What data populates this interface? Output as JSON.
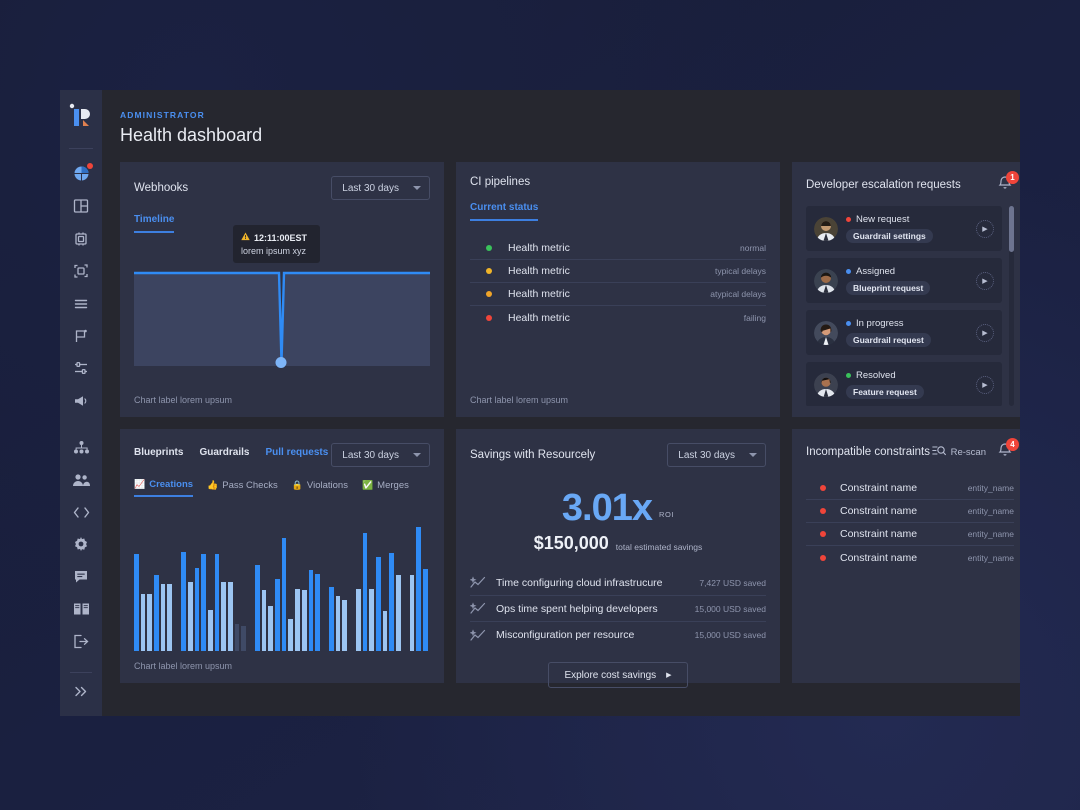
{
  "header": {
    "eyebrow": "ADMINISTRATOR",
    "title": "Health dashboard"
  },
  "sidebar": {
    "logo_name": "resourcely-logo",
    "items": [
      {
        "icon": "pie-chart-icon",
        "name": "dashboard",
        "has_dot": true
      },
      {
        "icon": "layout-panels-icon",
        "name": "blueprints",
        "has_dot": false
      },
      {
        "icon": "chip-icon",
        "name": "resources",
        "has_dot": false
      },
      {
        "icon": "frame-icon",
        "name": "guardrails",
        "has_dot": false
      },
      {
        "icon": "list-lines-icon",
        "name": "logs",
        "has_dot": false
      },
      {
        "icon": "flag-icon",
        "name": "campaigns",
        "has_dot": false
      },
      {
        "icon": "sliders-icon",
        "name": "settings-tuning",
        "has_dot": false
      },
      {
        "icon": "megaphone-icon",
        "name": "announcements",
        "has_dot": false
      },
      {
        "icon": "org-chart-icon",
        "name": "teams",
        "has_dot": false
      },
      {
        "icon": "users-icon",
        "name": "users",
        "has_dot": false
      }
    ],
    "bottom_items": [
      {
        "icon": "code-brackets-icon",
        "name": "developers"
      },
      {
        "icon": "gear-icon",
        "name": "settings"
      },
      {
        "icon": "chat-icon",
        "name": "support-chat"
      },
      {
        "icon": "book-icon",
        "name": "documentation"
      },
      {
        "icon": "logout-icon",
        "name": "logout"
      }
    ],
    "expand": {
      "icon": "chevron-double-right-icon",
      "name": "expand-sidebar"
    }
  },
  "webhooks": {
    "title": "Webhooks",
    "range": "Last 30 days",
    "tabs": [
      {
        "label": "Timeline",
        "active": true
      }
    ],
    "tooltip": {
      "time": "12:11:00EST",
      "text": "lorem ipsum xyz",
      "icon": "warning-icon"
    },
    "chart_label": "Chart label lorem upsum"
  },
  "ci": {
    "title": "CI pipelines",
    "tabs": [
      {
        "label": "Current status",
        "active": true
      }
    ],
    "rows": [
      {
        "label": "Health metric",
        "status": "normal",
        "color": "#3ac25b"
      },
      {
        "label": "Health metric",
        "status": "typical delays",
        "color": "#f0b429"
      },
      {
        "label": "Health metric",
        "status": "atypical delays",
        "color": "#f0a429"
      },
      {
        "label": "Health metric",
        "status": "failing",
        "color": "#f0453a"
      }
    ],
    "chart_label": "Chart label lorem upsum"
  },
  "escalation": {
    "title": "Developer escalation requests",
    "badge": "1",
    "bell_icon": "bell-icon",
    "items": [
      {
        "status": "New request",
        "dot": "#f0453a",
        "chip": "Guardrail settings",
        "avatar": "avatar-1"
      },
      {
        "status": "Assigned",
        "dot": "#4a8ff0",
        "chip": "Blueprint request",
        "avatar": "avatar-2"
      },
      {
        "status": "In progress",
        "dot": "#4a8ff0",
        "chip": "Guardrail request",
        "avatar": "avatar-3"
      },
      {
        "status": "Resolved",
        "dot": "#3ac25b",
        "chip": "Feature request",
        "avatar": "avatar-4"
      }
    ]
  },
  "activity": {
    "tabs": [
      {
        "label": "Blueprints",
        "active": false
      },
      {
        "label": "Guardrails",
        "active": false
      },
      {
        "label": "Pull requests",
        "active": true
      }
    ],
    "range": "Last 30 days",
    "subtabs": [
      {
        "label": "Creations",
        "emoji": "📈",
        "active": true
      },
      {
        "label": "Pass Checks",
        "emoji": "👍",
        "active": false
      },
      {
        "label": "Violations",
        "emoji": "🔒",
        "active": false
      },
      {
        "label": "Merges",
        "emoji": "✅",
        "active": false
      }
    ],
    "chart_label": "Chart label lorem upsum"
  },
  "savings": {
    "title": "Savings with Resourcely",
    "range": "Last 30 days",
    "roi_value": "3.01x",
    "roi_label": "ROI",
    "total_value": "$150,000",
    "total_label": "total estimated savings",
    "rows": [
      {
        "label": "Time configuring cloud infrastrucure",
        "amount": "7,427 USD saved",
        "icon": "sparkle-chart-icon"
      },
      {
        "label": "Ops time spent helping developers",
        "amount": "15,000 USD saved",
        "icon": "sparkle-chart-icon"
      },
      {
        "label": "Misconfiguration per resource",
        "amount": "15,000 USD saved",
        "icon": "sparkle-chart-icon"
      }
    ],
    "cta": "Explore cost savings"
  },
  "constraints": {
    "title": "Incompatible constraints",
    "rescan_label": "Re-scan",
    "rescan_icon": "scan-search-icon",
    "badge": "4",
    "bell_icon": "bell-icon",
    "rows": [
      {
        "name": "Constraint name",
        "entity": "entity_name"
      },
      {
        "name": "Constraint name",
        "entity": "entity_name"
      },
      {
        "name": "Constraint name",
        "entity": "entity_name"
      },
      {
        "name": "Constraint name",
        "entity": "entity_name"
      }
    ]
  },
  "chart_data": [
    {
      "type": "area",
      "title": "Webhooks Timeline",
      "xlabel": "",
      "ylabel": "",
      "legend": "none",
      "grid": false,
      "line_color": "#2f8bf5",
      "fill_color": "#3c4460",
      "annotation": {
        "time": "12:11:00EST",
        "text": "lorem ipsum xyz",
        "x_index": 41
      },
      "x": [
        0,
        10,
        20,
        30,
        39,
        40,
        41,
        42,
        43,
        50,
        60,
        70,
        80,
        90,
        100
      ],
      "y": [
        100,
        100,
        100,
        100,
        100,
        52,
        0,
        52,
        100,
        100,
        100,
        100,
        100,
        100,
        100
      ],
      "ylim": [
        0,
        100
      ]
    },
    {
      "type": "bar",
      "title": "Pull requests - Creations",
      "xlabel": "",
      "ylabel": "",
      "grid": false,
      "legend": "none",
      "ylim": [
        0,
        100
      ],
      "colors": {
        "primary": "#2f8bf5",
        "secondary": "#9cc5f2",
        "muted": "#3f4a66"
      },
      "groups": [
        {
          "values": [
            78,
            46,
            46,
            61,
            54,
            54
          ],
          "colors": [
            "primary",
            "secondary",
            "secondary",
            "primary",
            "secondary",
            "secondary"
          ]
        },
        {
          "values": [
            80,
            56,
            67,
            78,
            33,
            78,
            56,
            56,
            22,
            20
          ],
          "colors": [
            "primary",
            "secondary",
            "primary",
            "primary",
            "secondary",
            "primary",
            "secondary",
            "secondary",
            "muted",
            "muted"
          ]
        },
        {
          "values": [
            69,
            49,
            36,
            58,
            91,
            26,
            50,
            49,
            65,
            62
          ],
          "colors": [
            "primary",
            "secondary",
            "secondary",
            "primary",
            "primary",
            "secondary",
            "secondary",
            "secondary",
            "primary",
            "primary"
          ]
        },
        {
          "values": [
            52,
            44,
            41
          ],
          "colors": [
            "primary",
            "secondary",
            "secondary"
          ]
        },
        {
          "values": [
            50,
            95,
            50,
            76,
            32,
            79,
            61
          ],
          "colors": [
            "secondary",
            "primary",
            "secondary",
            "primary",
            "secondary",
            "primary",
            "secondary"
          ]
        },
        {
          "values": [
            61,
            100,
            66
          ],
          "colors": [
            "secondary",
            "primary",
            "primary"
          ]
        }
      ]
    }
  ]
}
